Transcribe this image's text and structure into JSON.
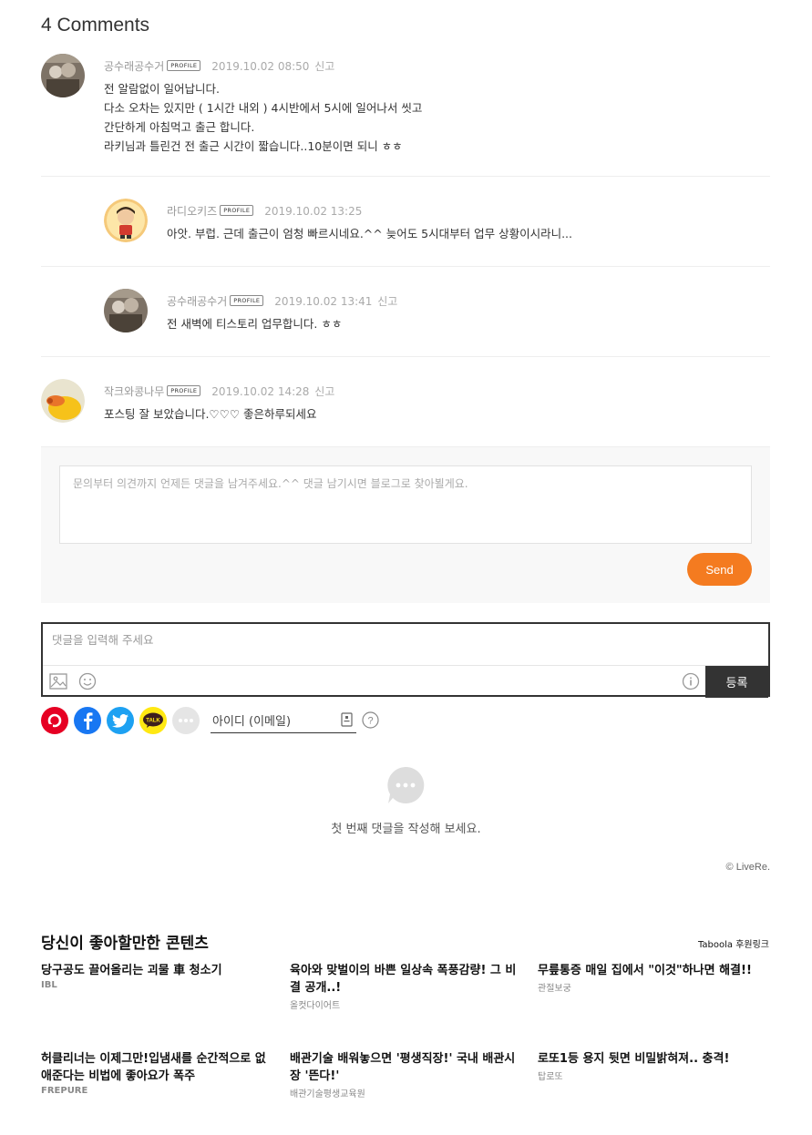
{
  "comments_header": {
    "title": "4 Comments"
  },
  "comments": [
    {
      "author": "공수래공수거",
      "profile_tag": "PROFILE",
      "date": "2019.10.02 08:50",
      "report": "신고",
      "lines": [
        "전 알람없이 일어납니다.",
        "다소 오차는 있지만 ( 1시간 내외 ) 4시반에서 5시에 일어나서 씻고",
        "간단하게 아침먹고 출근 합니다.",
        "라키님과 틀린건 전 출근 시간이 짧습니다..10분이면 되니 ㅎㅎ"
      ]
    },
    {
      "author": "라디오키즈",
      "profile_tag": "PROFILE",
      "date": "2019.10.02 13:25",
      "report": "",
      "lines": [
        "아앗. 부럽. 근데 출근이 엄청 빠르시네요.^^ 늦어도 5시대부터 업무 상황이시라니..."
      ]
    },
    {
      "author": "공수래공수거",
      "profile_tag": "PROFILE",
      "date": "2019.10.02 13:41",
      "report": "신고",
      "lines": [
        "전 새벽에 티스토리 업무합니다. ㅎㅎ"
      ]
    },
    {
      "author": "작크와콩나무",
      "profile_tag": "PROFILE",
      "date": "2019.10.02 14:28",
      "report": "신고",
      "lines": [
        "포스팅 잘 보았습니다.♡♡♡ 좋은하루되세요"
      ]
    }
  ],
  "comment_form": {
    "placeholder": "문의부터 의견까지 언제든 댓글을 남겨주세요.^^ 댓글 남기시면 블로그로 찾아뵐게요.",
    "send_label": "Send"
  },
  "livere": {
    "input_placeholder": "댓글을 입력해 주세요",
    "submit_label": "등록",
    "id_placeholder": "아이디 (이메일)",
    "empty_text": "첫 번째 댓글을 작성해 보세요.",
    "brand": "LiveRe.",
    "kakao_label": "TALK"
  },
  "recommendations": {
    "title": "당신이 좋아할만한 콘텐츠",
    "sponsor": "Taboola 후원링크",
    "items": [
      {
        "headline": "당구공도 끌어올리는 괴물 車 청소기",
        "source": "IBL"
      },
      {
        "headline": "육아와 맞벌이의 바쁜 일상속 폭풍감량! 그 비결 공개..!",
        "source": "올컷다이어트"
      },
      {
        "headline": "무릎통증 매일 집에서 \"이것\"하나면 해결!!",
        "source": "관절보궁"
      },
      {
        "headline": "허클리너는 이제그만!입냄새를 순간적으로 없애준다는 비법에 좋아요가 폭주",
        "source": "FREPURE"
      },
      {
        "headline": "배관기술 배워놓으면 '평생직장!' 국내 배관시장 '뜬다!'",
        "source": "배관기술평생교육원"
      },
      {
        "headline": "로또1등 용지 뒷면 비밀밝혀져.. 충격!",
        "source": "탑로또"
      }
    ]
  },
  "colors": {
    "accent": "#f47b20",
    "pinterest": "#e60023",
    "facebook": "#1877f2",
    "twitter": "#1da1f2",
    "kakao": "#ffe812"
  }
}
